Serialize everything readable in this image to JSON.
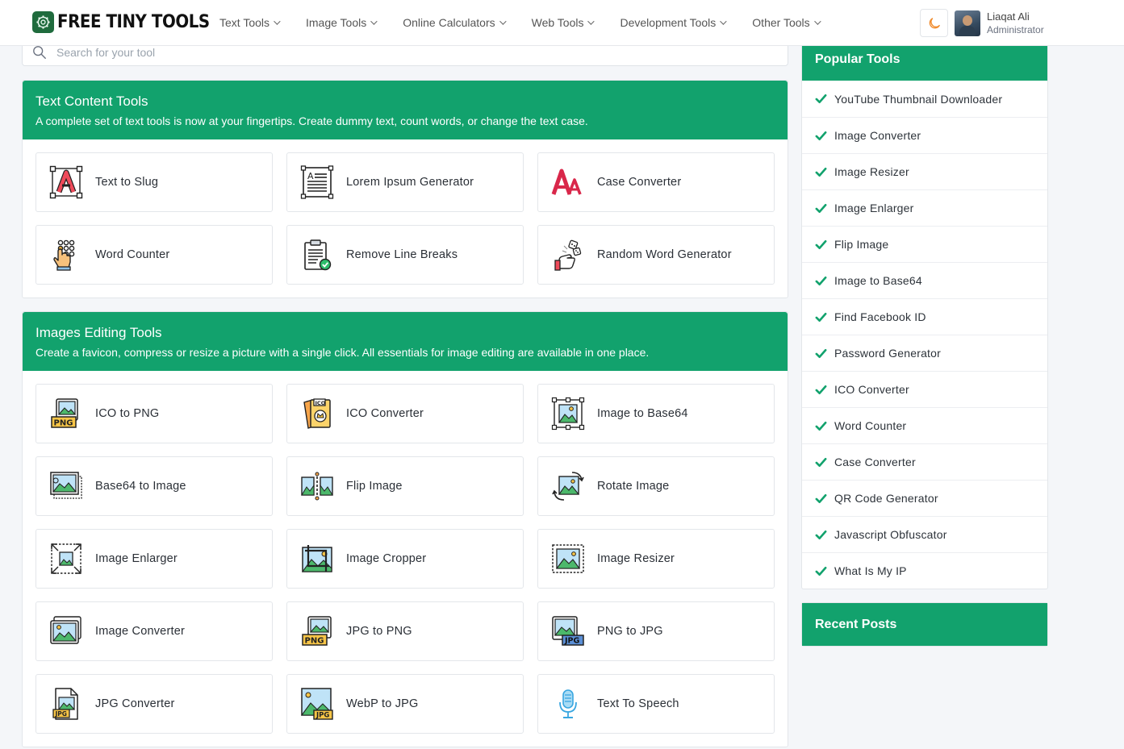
{
  "brand": {
    "name": "FREE TINY TOOLS",
    "logo_icon": "gear-brain-icon",
    "accent": "#12a26d"
  },
  "nav": {
    "items": [
      {
        "label": "Text Tools"
      },
      {
        "label": "Image Tools"
      },
      {
        "label": "Online Calculators"
      },
      {
        "label": "Web Tools"
      },
      {
        "label": "Development Tools"
      },
      {
        "label": "Other Tools"
      }
    ],
    "theme_icon": "moon-icon"
  },
  "user": {
    "name": "Liaqat Ali",
    "role": "Administrator"
  },
  "search": {
    "placeholder": "Search for your tool",
    "value": ""
  },
  "sections": [
    {
      "title": "Text Content Tools",
      "subtitle": "A complete set of text tools is now at your fingertips. Create dummy text, count words, or change the text case.",
      "tools": [
        {
          "label": "Text to Slug",
          "icon": "text-slug-icon"
        },
        {
          "label": "Lorem Ipsum Generator",
          "icon": "document-text-icon"
        },
        {
          "label": "Case Converter",
          "icon": "font-case-icon"
        },
        {
          "label": "Word Counter",
          "icon": "hand-counter-icon"
        },
        {
          "label": "Remove Line Breaks",
          "icon": "clipboard-check-icon"
        },
        {
          "label": "Random Word Generator",
          "icon": "dice-hand-icon"
        }
      ]
    },
    {
      "title": "Images Editing Tools",
      "subtitle": "Create a favicon, compress or resize a picture with a single click. All essentials for image editing are available in one place.",
      "tools": [
        {
          "label": "ICO to PNG",
          "icon": "ico-to-png-icon",
          "badge": "PNG"
        },
        {
          "label": "ICO Converter",
          "icon": "ico-converter-icon",
          "badge": "ICO"
        },
        {
          "label": "Image to Base64",
          "icon": "image-frame-icon"
        },
        {
          "label": "Base64 to Image",
          "icon": "image-stack-icon"
        },
        {
          "label": "Flip Image",
          "icon": "flip-image-icon"
        },
        {
          "label": "Rotate Image",
          "icon": "rotate-image-icon"
        },
        {
          "label": "Image Enlarger",
          "icon": "enlarge-image-icon"
        },
        {
          "label": "Image Cropper",
          "icon": "crop-image-icon"
        },
        {
          "label": "Image Resizer",
          "icon": "resize-image-icon"
        },
        {
          "label": "Image Converter",
          "icon": "image-convert-icon"
        },
        {
          "label": "JPG to PNG",
          "icon": "jpg-to-png-icon",
          "badge": "PNG"
        },
        {
          "label": "PNG to JPG",
          "icon": "png-to-jpg-icon",
          "badge": "JPG"
        },
        {
          "label": "JPG Converter",
          "icon": "jpg-file-icon",
          "badge": "JPG"
        },
        {
          "label": "WebP to JPG",
          "icon": "webp-to-jpg-icon",
          "badge": "JPG"
        },
        {
          "label": "Text To Speech",
          "icon": "microphone-icon"
        }
      ]
    }
  ],
  "popular": {
    "title": "Popular Tools",
    "items": [
      {
        "label": "YouTube Thumbnail Downloader"
      },
      {
        "label": "Image Converter"
      },
      {
        "label": "Image Resizer"
      },
      {
        "label": "Image Enlarger"
      },
      {
        "label": "Flip Image"
      },
      {
        "label": "Image to Base64"
      },
      {
        "label": "Find Facebook ID"
      },
      {
        "label": "Password Generator"
      },
      {
        "label": "ICO Converter"
      },
      {
        "label": "Word Counter"
      },
      {
        "label": "Case Converter"
      },
      {
        "label": "QR Code Generator"
      },
      {
        "label": "Javascript Obfuscator"
      },
      {
        "label": "What Is My IP"
      }
    ]
  },
  "recent": {
    "title": "Recent Posts"
  }
}
